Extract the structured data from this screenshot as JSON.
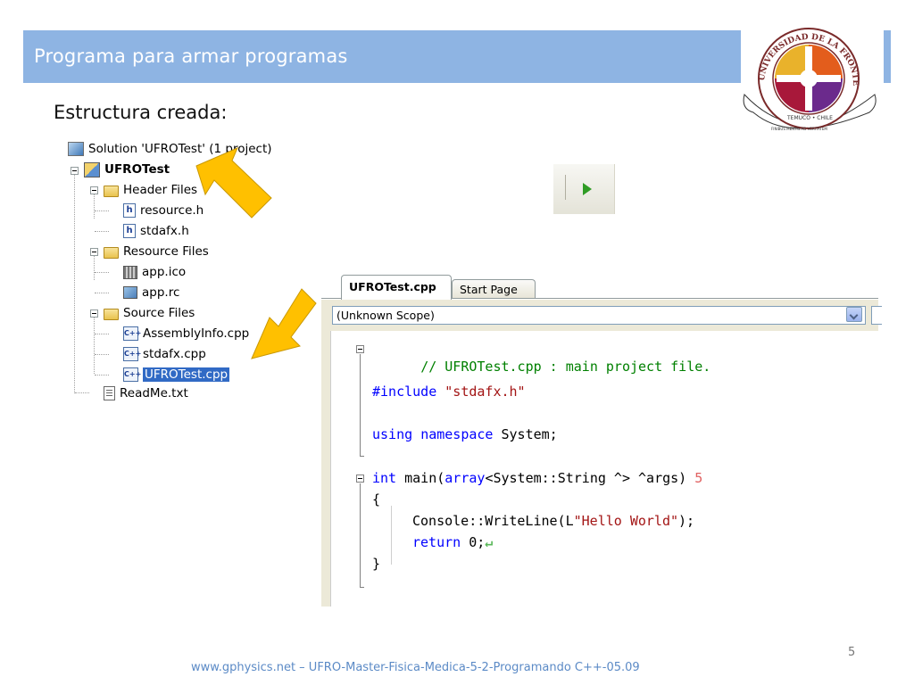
{
  "slide": {
    "title": "Programa para armar programas",
    "subtitle": "Estructura creada:",
    "number": "5",
    "footer": "www.gphysics.net – UFRO-Master-Fisica-Medica-5-2-Programando C++-05.09"
  },
  "logo": {
    "text_top": "UNIVERSIDAD DE LA FRONTERA",
    "text_city": "TEMUCO • CHILE",
    "motto": "FINIBUS MENTIS AD VERITATEM"
  },
  "solution_explorer": {
    "items": [
      {
        "label": "Solution 'UFROTest' (1 project)",
        "icon": "solution-icon"
      },
      {
        "label": "UFROTest",
        "icon": "project-icon"
      },
      {
        "label": "Header Files",
        "icon": "folder-icon"
      },
      {
        "label": "resource.h",
        "icon": "header-file-icon"
      },
      {
        "label": "stdafx.h",
        "icon": "header-file-icon"
      },
      {
        "label": "Resource Files",
        "icon": "folder-icon"
      },
      {
        "label": "app.ico",
        "icon": "icon-file-icon"
      },
      {
        "label": "app.rc",
        "icon": "resource-file-icon"
      },
      {
        "label": "Source Files",
        "icon": "folder-icon"
      },
      {
        "label": "AssemblyInfo.cpp",
        "icon": "cpp-file-icon"
      },
      {
        "label": "stdafx.cpp",
        "icon": "cpp-file-icon"
      },
      {
        "label": "UFROTest.cpp",
        "icon": "cpp-file-icon"
      },
      {
        "label": "ReadMe.txt",
        "icon": "text-file-icon"
      }
    ]
  },
  "toolbar": {
    "run_icon": "play-icon"
  },
  "editor": {
    "tabs": [
      {
        "label": "UFROTest.cpp"
      },
      {
        "label": "Start Page"
      }
    ],
    "scope": "(Unknown Scope)",
    "code": {
      "l1": "// UFROTest.cpp : main project file.",
      "l2_kw": "#include",
      "l2_str": " \"stdafx.h\"",
      "l3_kw1": "using",
      "l3_kw2": "namespace",
      "l3_rest": " System;",
      "l4_kw1": "int",
      "l4_mid": " main(",
      "l4_kw2": "array",
      "l4_rest": "<System::String ^> ^args)",
      "l4_num": "5",
      "l5": "{",
      "l6_pre": "Console::WriteLine(L",
      "l6_str": "\"Hello World\"",
      "l6_post": ");",
      "l7_kw": "return",
      "l7_rest": " 0;",
      "l7_ret": "↵",
      "l8": "}"
    }
  },
  "colors": {
    "title_bar": "#8eb4e3",
    "arrow": "#ffc000",
    "keyword": "#0000ff",
    "comment": "#008000",
    "string": "#a31515",
    "selection": "#316ac5"
  }
}
